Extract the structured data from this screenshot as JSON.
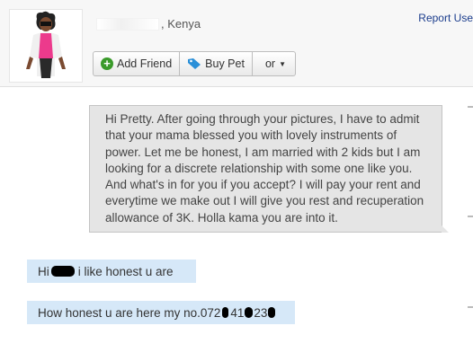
{
  "profile": {
    "location": ", Kenya",
    "report_label": "Report Use"
  },
  "actions": {
    "add_friend": "Add Friend",
    "buy_pet": "Buy Pet",
    "or": "or"
  },
  "messages": [
    {
      "direction": "incoming",
      "text": "Hi Pretty. After going through your pictures, I have to admit that your mama blessed you with lovely instruments of power. Let me be honest, I am married with 2 kids but I am looking for a discrete relationship with some one like you. And what's in for you if you accept? I will pay your rent and everytime we make out I will give you rest and recuperation allowance of 3K. Holla kama you are into it."
    },
    {
      "direction": "outgoing",
      "parts": [
        "Hi",
        "i like honest u are"
      ]
    },
    {
      "direction": "outgoing",
      "parts": [
        "How honest u are here my no.072",
        "41",
        "23"
      ]
    }
  ],
  "colors": {
    "incoming_bubble": "#e5e5e5",
    "outgoing_bubble": "#d6e8f8",
    "link": "#1a3c8c",
    "add_icon": "#3a9a2a",
    "tag_icon": "#2a8fd8"
  },
  "icons": [
    "plus-circle-icon",
    "price-tag-icon",
    "caret-down-icon"
  ]
}
